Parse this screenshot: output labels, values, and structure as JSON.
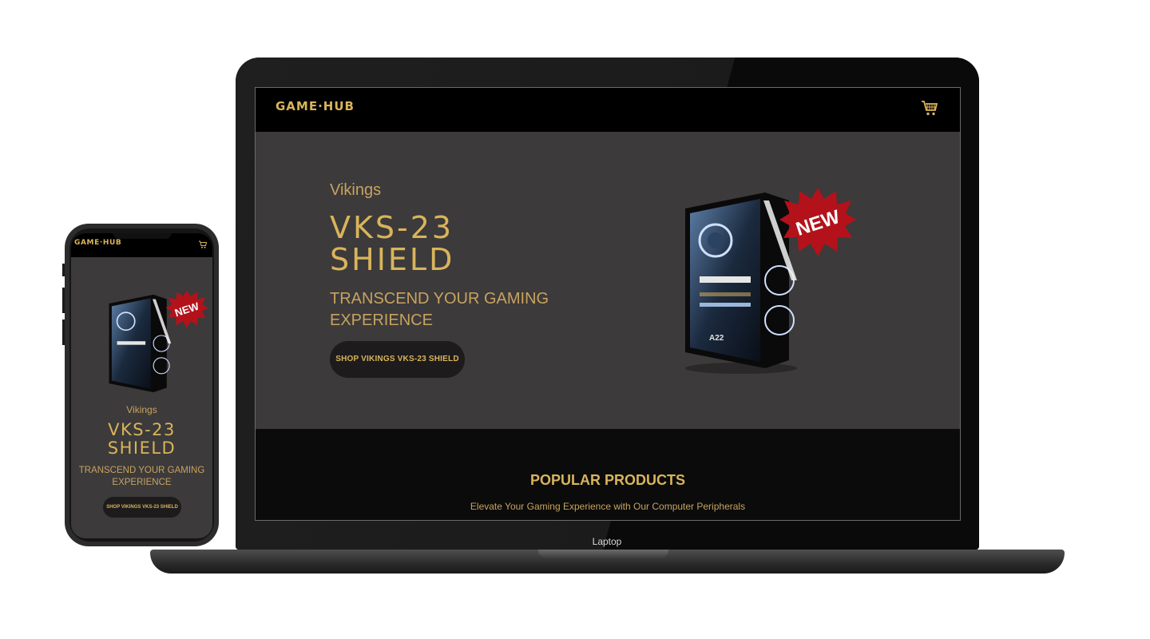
{
  "device_labels": {
    "laptop": "Laptop"
  },
  "site": {
    "logo": "GAME·HUB",
    "cart_icon": "shopping-cart-icon",
    "hero": {
      "brand": "Vikings",
      "title": "VKS-23 SHIELD",
      "tagline": "TRANSCEND YOUR GAMING EXPERIENCE",
      "button": "SHOP VIKINGS VKS-23 SHIELD",
      "badge": "NEW"
    },
    "popular": {
      "title": "POPULAR PRODUCTS",
      "subtitle": "Elevate Your Gaming Experience with Our Computer Peripherals"
    }
  },
  "colors": {
    "accent_gold": "#d9b45a",
    "hero_bg": "#3c3a3b",
    "nav_bg": "#000000",
    "badge_red": "#b3121b"
  }
}
